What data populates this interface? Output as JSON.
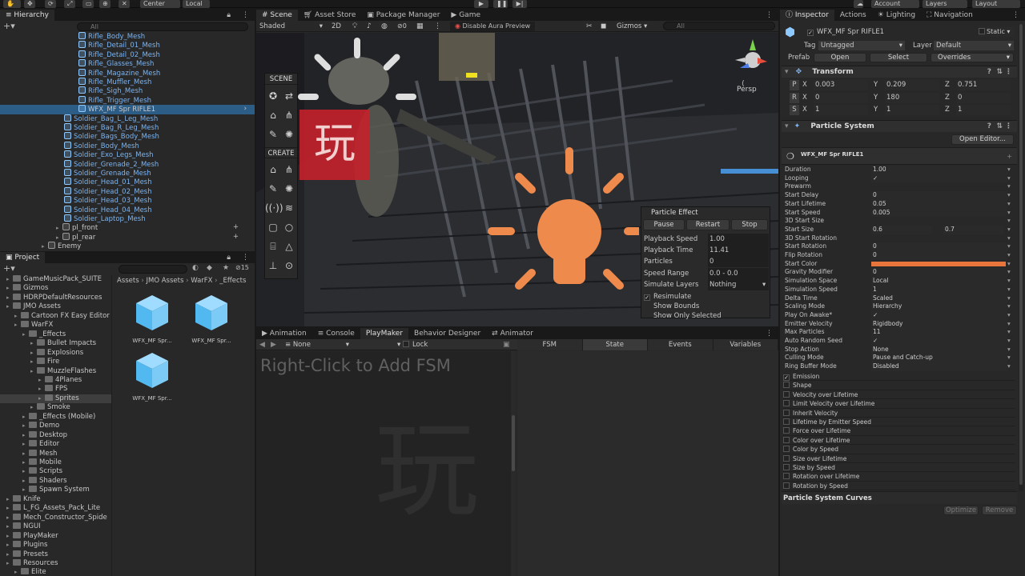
{
  "toolbar": {
    "center_label": "Center",
    "local_label": "Local",
    "account_label": "Account",
    "layers_label": "Layers",
    "layout_label": "Layout"
  },
  "hierarchy": {
    "tab": "Hierarchy",
    "search_placeholder": "All",
    "rows": [
      {
        "label": "Rifle_Body_Mesh",
        "indent": 2
      },
      {
        "label": "Rifle_Detail_01_Mesh",
        "indent": 2
      },
      {
        "label": "Rifle_Detail_02_Mesh",
        "indent": 2
      },
      {
        "label": "Rifle_Glasses_Mesh",
        "indent": 2
      },
      {
        "label": "Rifle_Magazine_Mesh",
        "indent": 2
      },
      {
        "label": "Rifle_Muffler_Mesh",
        "indent": 2
      },
      {
        "label": "Rifle_Sigh_Mesh",
        "indent": 2
      },
      {
        "label": "Rifle_Trigger_Mesh",
        "indent": 2
      },
      {
        "label": "WFX_MF Spr RIFLE1",
        "indent": 2,
        "selected": true
      },
      {
        "label": "Soldier_Bag_L_Leg_Mesh",
        "indent": 1
      },
      {
        "label": "Soldier_Bag_R_Leg_Mesh",
        "indent": 1
      },
      {
        "label": "Soldier_Bags_Body_Mesh",
        "indent": 1
      },
      {
        "label": "Soldier_Body_Mesh",
        "indent": 1
      },
      {
        "label": "Soldier_Exo_Legs_Mesh",
        "indent": 1
      },
      {
        "label": "Soldier_Grenade_2_Mesh",
        "indent": 1
      },
      {
        "label": "Soldier_Grenade_Mesh",
        "indent": 1
      },
      {
        "label": "Soldier_Head_01_Mesh",
        "indent": 1
      },
      {
        "label": "Soldier_Head_02_Mesh",
        "indent": 1
      },
      {
        "label": "Soldier_Head_03_Mesh",
        "indent": 1
      },
      {
        "label": "Soldier_Head_04_Mesh",
        "indent": 1
      },
      {
        "label": "Soldier_Laptop_Mesh",
        "indent": 1
      },
      {
        "label": "pl_front",
        "indent": 0,
        "plain": true
      },
      {
        "label": "pl_rear",
        "indent": 0,
        "plain": true
      },
      {
        "label": "Enemy",
        "indent": -1,
        "plain": true
      }
    ]
  },
  "project": {
    "tab": "Project",
    "hidden_count": "15",
    "breadcrumb": [
      "Assets",
      "JMO Assets",
      "WarFX",
      "_Effects"
    ],
    "tree": [
      {
        "label": "GameMusicPack_SUITE",
        "indent": 1
      },
      {
        "label": "Gizmos",
        "indent": 1
      },
      {
        "label": "HDRPDefaultResources",
        "indent": 1
      },
      {
        "label": "JMO Assets",
        "indent": 1
      },
      {
        "label": "Cartoon FX Easy Editor",
        "indent": 2
      },
      {
        "label": "WarFX",
        "indent": 2
      },
      {
        "label": "_Effects",
        "indent": 3
      },
      {
        "label": "Bullet Impacts",
        "indent": 4
      },
      {
        "label": "Explosions",
        "indent": 4
      },
      {
        "label": "Fire",
        "indent": 4
      },
      {
        "label": "MuzzleFlashes",
        "indent": 4
      },
      {
        "label": "4Planes",
        "indent": 5
      },
      {
        "label": "FPS",
        "indent": 5
      },
      {
        "label": "Sprites",
        "indent": 5,
        "selected": true
      },
      {
        "label": "Smoke",
        "indent": 4
      },
      {
        "label": "_Effects (Mobile)",
        "indent": 3
      },
      {
        "label": "Demo",
        "indent": 3
      },
      {
        "label": "Desktop",
        "indent": 3
      },
      {
        "label": "Editor",
        "indent": 3
      },
      {
        "label": "Mesh",
        "indent": 3
      },
      {
        "label": "Mobile",
        "indent": 3
      },
      {
        "label": "Scripts",
        "indent": 3
      },
      {
        "label": "Shaders",
        "indent": 3
      },
      {
        "label": "Spawn System",
        "indent": 3
      },
      {
        "label": "Knife",
        "indent": 1
      },
      {
        "label": "L_FG_Assets_Pack_Lite",
        "indent": 1
      },
      {
        "label": "Mech_Constructor_Spide",
        "indent": 1
      },
      {
        "label": "NGUI",
        "indent": 1
      },
      {
        "label": "PlayMaker",
        "indent": 1
      },
      {
        "label": "Plugins",
        "indent": 1
      },
      {
        "label": "Presets",
        "indent": 1
      },
      {
        "label": "Resources",
        "indent": 1
      },
      {
        "label": "Elite",
        "indent": 2
      }
    ],
    "assets": [
      "WFX_MF Spr...",
      "WFX_MF Spr...",
      "WFX_MF Spr..."
    ]
  },
  "scene": {
    "tabs": [
      "Scene",
      "Asset Store",
      "Package Manager",
      "Game"
    ],
    "shading": "Shaded",
    "mode_2d": "2D",
    "fx_count": "0",
    "aura_label": "Disable Aura Preview",
    "gizmos_label": "Gizmos",
    "search_placeholder": "All",
    "persp_label": "Persp",
    "scene_section": "SCENE",
    "create_section": "CREATE"
  },
  "particle_effect": {
    "title": "Particle Effect",
    "pause": "Pause",
    "restart": "Restart",
    "stop": "Stop",
    "rows": [
      {
        "label": "Playback Speed",
        "value": "1.00"
      },
      {
        "label": "Playback Time",
        "value": "11.41"
      },
      {
        "label": "Particles",
        "value": "0"
      },
      {
        "label": "Speed Range",
        "value": "0.0 - 0.0"
      },
      {
        "label": "Simulate Layers",
        "value": "Nothing"
      }
    ],
    "resimulate": "Resimulate",
    "show_bounds": "Show Bounds",
    "show_only_selected": "Show Only Selected"
  },
  "bottom": {
    "tabs": [
      "Animation",
      "Console",
      "PlayMaker",
      "Behavior Designer",
      "Animator"
    ],
    "fsm_none": "None",
    "lock": "Lock",
    "hint": "Right-Click to Add FSM",
    "columns": [
      "FSM",
      "State",
      "Events",
      "Variables"
    ]
  },
  "inspector": {
    "tabs": [
      "Inspector",
      "Actions",
      "Lighting",
      "Navigation"
    ],
    "object_name": "WFX_MF Spr RIFLE1",
    "static_label": "Static",
    "tag_label": "Tag",
    "tag_value": "Untagged",
    "layer_label": "Layer",
    "layer_value": "Default",
    "prefab_label": "Prefab",
    "open": "Open",
    "select": "Select",
    "overrides": "Overrides",
    "transform": {
      "title": "Transform",
      "rows": [
        {
          "label": "P",
          "x": "0.003",
          "y": "0.209",
          "z": "0.751"
        },
        {
          "label": "R",
          "x": "0",
          "y": "180",
          "z": "0"
        },
        {
          "label": "S",
          "x": "1",
          "y": "1",
          "z": "1"
        }
      ]
    },
    "particle_system": {
      "title": "Particle System",
      "open_editor": "Open Editor...",
      "sub_name": "WFX_MF Spr RIFLE1",
      "properties": [
        {
          "label": "Duration",
          "value": "1.00"
        },
        {
          "label": "Looping",
          "value": "✓"
        },
        {
          "label": "Prewarm",
          "value": ""
        },
        {
          "label": "Start Delay",
          "value": "0"
        },
        {
          "label": "Start Lifetime",
          "value": "0.05"
        },
        {
          "label": "Start Speed",
          "value": "0.005"
        },
        {
          "label": "3D Start Size",
          "value": ""
        },
        {
          "label": "Start Size",
          "value": "0.6",
          "value2": "0.7"
        },
        {
          "label": "3D Start Rotation",
          "value": ""
        },
        {
          "label": "Start Rotation",
          "value": "0"
        },
        {
          "label": "Flip Rotation",
          "value": "0"
        },
        {
          "label": "Start Color",
          "value": ""
        },
        {
          "label": "Gravity Modifier",
          "value": "0"
        },
        {
          "label": "Simulation Space",
          "value": "Local"
        },
        {
          "label": "Simulation Speed",
          "value": "1"
        },
        {
          "label": "Delta Time",
          "value": "Scaled"
        },
        {
          "label": "Scaling Mode",
          "value": "Hierarchy"
        },
        {
          "label": "Play On Awake*",
          "value": "✓"
        },
        {
          "label": "Emitter Velocity",
          "value": "Rigidbody"
        },
        {
          "label": "Max Particles",
          "value": "11"
        },
        {
          "label": "Auto Random Seed",
          "value": "✓"
        },
        {
          "label": "Stop Action",
          "value": "None"
        },
        {
          "label": "Culling Mode",
          "value": "Pause and Catch-up"
        },
        {
          "label": "Ring Buffer Mode",
          "value": "Disabled"
        }
      ],
      "start_color": "#e8763c",
      "modules": [
        {
          "label": "Emission",
          "checked": true
        },
        {
          "label": "Shape",
          "checked": false
        },
        {
          "label": "Velocity over Lifetime",
          "checked": false
        },
        {
          "label": "Limit Velocity over Lifetime",
          "checked": false
        },
        {
          "label": "Inherit Velocity",
          "checked": false
        },
        {
          "label": "Lifetime by Emitter Speed",
          "checked": false
        },
        {
          "label": "Force over Lifetime",
          "checked": false
        },
        {
          "label": "Color over Lifetime",
          "checked": false
        },
        {
          "label": "Color by Speed",
          "checked": false
        },
        {
          "label": "Size over Lifetime",
          "checked": false
        },
        {
          "label": "Size by Speed",
          "checked": false
        },
        {
          "label": "Rotation over Lifetime",
          "checked": false
        },
        {
          "label": "Rotation by Speed",
          "checked": false
        }
      ]
    },
    "curves_title": "Particle System Curves",
    "optimize": "Optimize",
    "remove": "Remove"
  },
  "colors": {
    "accent_orange": "#e8894f",
    "selection_blue": "#2c5d87",
    "prefab_blue": "#7cb4f0"
  }
}
